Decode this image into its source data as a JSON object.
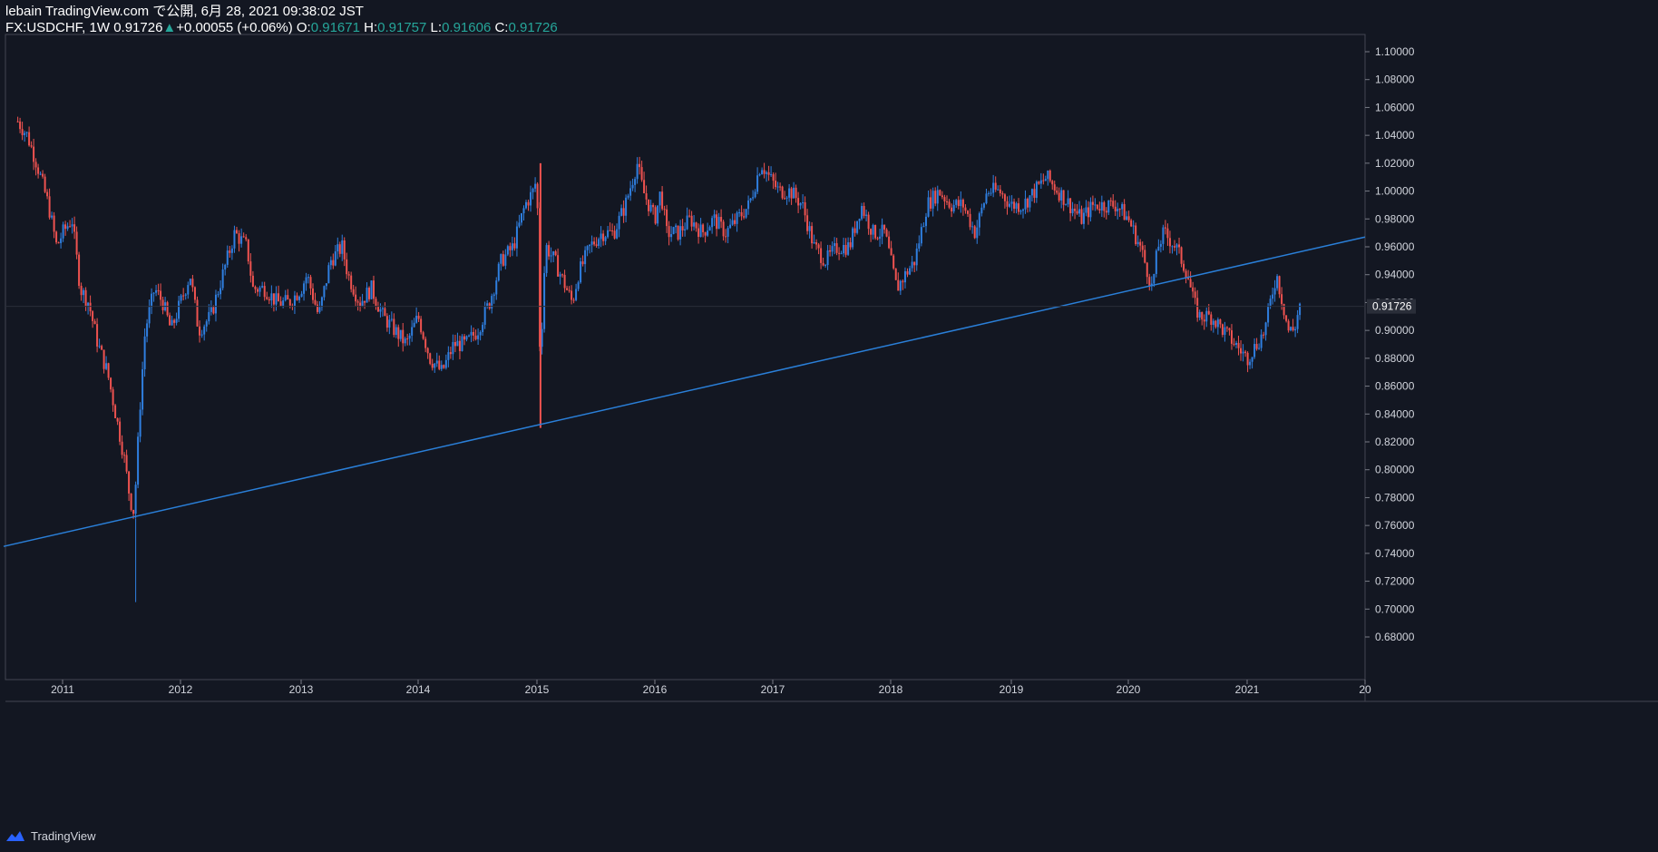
{
  "header": {
    "published": "lebain TradingView.com で公開, 6月 28, 2021 09:38:02 JST",
    "symbol": "FX:USDCHF, 1W",
    "last": "0.91726",
    "change": "+0.00055 (+0.06%)",
    "o_label": "O:",
    "o_value": "0.91671",
    "h_label": "H:",
    "h_value": "0.91757",
    "l_label": "L:",
    "l_value": "0.91606",
    "c_label": "C:",
    "c_value": "0.91726"
  },
  "footer": {
    "brand": "TradingView"
  },
  "colors": {
    "background": "#131722",
    "up": "#2f7fe0",
    "down": "#ef5350",
    "trendline": "#2a7fd8",
    "teal": "#26a69a"
  },
  "chart_data": {
    "type": "line",
    "title": "FX:USDCHF, 1W",
    "ylim": [
      0.67,
      1.11
    ],
    "y_ticks": [
      "0.68000",
      "0.70000",
      "0.72000",
      "0.74000",
      "0.76000",
      "0.78000",
      "0.80000",
      "0.82000",
      "0.84000",
      "0.86000",
      "0.88000",
      "0.90000",
      "0.92000",
      "0.94000",
      "0.96000",
      "0.98000",
      "1.00000",
      "1.02000",
      "1.04000",
      "1.06000",
      "1.08000",
      "1.10000"
    ],
    "x_ticks": [
      "2011",
      "2012",
      "2013",
      "2014",
      "2015",
      "2016",
      "2017",
      "2018",
      "2019",
      "2020",
      "2021",
      "20"
    ],
    "current_price_label": "0.91726",
    "current_price": 0.91726,
    "series": [
      {
        "x": [
          2010.62,
          2010.7,
          2010.78,
          2010.88,
          2010.95,
          2011.0,
          2011.08,
          2011.15,
          2011.22,
          2011.3,
          2011.38,
          2011.45,
          2011.52,
          2011.57,
          2011.6,
          2011.62,
          2011.66,
          2011.7,
          2011.78,
          2011.85,
          2011.92,
          2012.0,
          2012.08,
          2012.15,
          2012.25,
          2012.35,
          2012.45,
          2012.55,
          2012.6,
          2012.7,
          2012.8,
          2012.9,
          2013.0,
          2013.05,
          2013.15,
          2013.25,
          2013.35,
          2013.4,
          2013.5,
          2013.6,
          2013.7,
          2013.8,
          2013.9,
          2014.0,
          2014.1,
          2014.2,
          2014.3,
          2014.4,
          2014.5,
          2014.6,
          2014.7,
          2014.8,
          2014.9,
          2014.97,
          2015.0,
          2015.03,
          2015.05,
          2015.08,
          2015.15,
          2015.2,
          2015.3,
          2015.35,
          2015.45,
          2015.55,
          2015.65,
          2015.75,
          2015.85,
          2015.9,
          2016.0,
          2016.05,
          2016.1,
          2016.2,
          2016.3,
          2016.4,
          2016.5,
          2016.6,
          2016.7,
          2016.8,
          2016.9,
          2016.97,
          2017.05,
          2017.15,
          2017.25,
          2017.35,
          2017.45,
          2017.55,
          2017.65,
          2017.75,
          2017.85,
          2017.95,
          2018.05,
          2018.12,
          2018.2,
          2018.3,
          2018.4,
          2018.5,
          2018.6,
          2018.7,
          2018.8,
          2018.9,
          2019.0,
          2019.1,
          2019.2,
          2019.3,
          2019.4,
          2019.5,
          2019.6,
          2019.7,
          2019.8,
          2019.9,
          2020.0,
          2020.1,
          2020.17,
          2020.2,
          2020.25,
          2020.3,
          2020.4,
          2020.5,
          2020.55,
          2020.6,
          2020.7,
          2020.8,
          2020.9,
          2021.0,
          2021.08,
          2021.15,
          2021.22,
          2021.25,
          2021.3,
          2021.35,
          2021.4,
          2021.45
        ],
        "values": [
          1.05,
          1.04,
          1.02,
          0.99,
          0.96,
          0.97,
          0.98,
          0.93,
          0.92,
          0.89,
          0.87,
          0.84,
          0.81,
          0.78,
          0.77,
          0.79,
          0.85,
          0.9,
          0.93,
          0.92,
          0.9,
          0.92,
          0.94,
          0.9,
          0.91,
          0.94,
          0.97,
          0.96,
          0.93,
          0.93,
          0.92,
          0.92,
          0.93,
          0.94,
          0.91,
          0.95,
          0.96,
          0.94,
          0.92,
          0.93,
          0.91,
          0.9,
          0.89,
          0.91,
          0.88,
          0.87,
          0.89,
          0.89,
          0.9,
          0.92,
          0.95,
          0.96,
          0.99,
          1.0,
          1.01,
          0.86,
          0.93,
          0.96,
          0.95,
          0.94,
          0.92,
          0.94,
          0.96,
          0.97,
          0.97,
          0.99,
          1.02,
          1.0,
          0.98,
          1.0,
          0.97,
          0.97,
          0.98,
          0.97,
          0.98,
          0.97,
          0.98,
          0.99,
          1.02,
          1.01,
          1.0,
          1.0,
          0.99,
          0.96,
          0.95,
          0.96,
          0.96,
          0.99,
          0.97,
          0.97,
          0.93,
          0.94,
          0.95,
          0.99,
          1.0,
          0.99,
          0.99,
          0.97,
          1.0,
          1.0,
          0.99,
          0.99,
          1.0,
          1.01,
          1.0,
          0.99,
          0.98,
          0.99,
          0.99,
          0.99,
          0.98,
          0.96,
          0.94,
          0.93,
          0.96,
          0.97,
          0.96,
          0.94,
          0.92,
          0.91,
          0.91,
          0.9,
          0.89,
          0.88,
          0.89,
          0.9,
          0.93,
          0.94,
          0.92,
          0.9,
          0.9,
          0.92
        ]
      }
    ],
    "trendline": {
      "from": [
        2010.5,
        0.745
      ],
      "to": [
        2022.0,
        0.967
      ]
    }
  }
}
